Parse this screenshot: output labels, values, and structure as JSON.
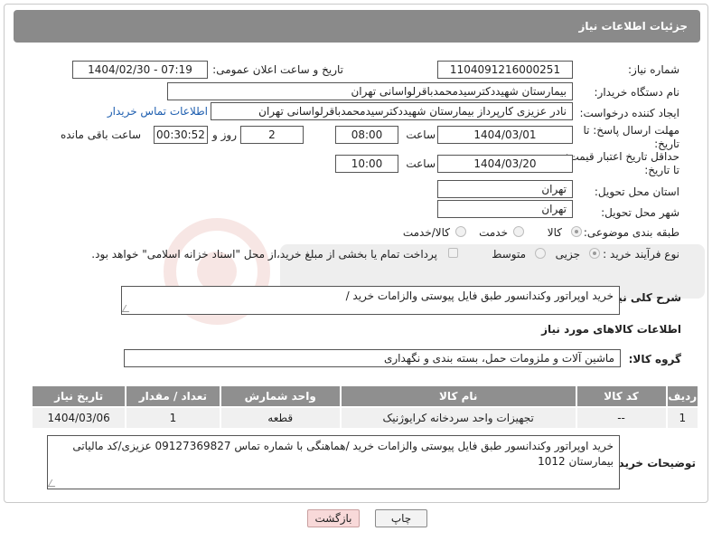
{
  "header": {
    "title": "جزئیات اطلاعات نیاز"
  },
  "fields": {
    "need_number_label": "شماره نیاز:",
    "need_number": "1104091216000251",
    "announce_label": "تاریخ و ساعت اعلان عمومی:",
    "announce_value": "1404/02/30 - 07:19",
    "buyer_org_label": "نام دستگاه خریدار:",
    "buyer_org": "بیمارستان شهیددکترسیدمحمدباقرلواسانی تهران",
    "creator_label": "ایجاد کننده درخواست:",
    "creator": "نادر  عزیزی کارپرداز بیمارستان شهیددکترسیدمحمدباقرلواسانی تهران",
    "contact_link": "اطلاعات تماس خریدار",
    "deadline_label_1": "مهلت ارسال پاسخ: تا",
    "deadline_label_2": "تاریخ:",
    "deadline_date": "1404/03/01",
    "time_label": "ساعت",
    "deadline_time": "08:00",
    "days_value": "2",
    "days_label": "روز و",
    "remaining_time": "00:30:52",
    "remaining_label": "ساعت باقی مانده",
    "min_validity_label_1": "حداقل تاریخ اعتبار قیمت:",
    "min_validity_label_2": "تا تاریخ:",
    "validity_date": "1404/03/20",
    "validity_time": "10:00",
    "province_label": "استان محل تحویل:",
    "province": "تهران",
    "city_label": "شهر محل تحویل:",
    "city": "تهران",
    "category_label": "طبقه بندی موضوعی:",
    "category_options": [
      "کالا",
      "خدمت",
      "کالا/خدمت"
    ],
    "process_label": "نوع فرآیند خرید :",
    "process_options": [
      "جزیی",
      "متوسط"
    ],
    "payment_note": "پرداخت تمام یا بخشی از مبلغ خرید،از محل \"اسناد خزانه اسلامی\" خواهد بود."
  },
  "summary": {
    "label": "شرح کلی نیاز:",
    "text": "خرید اوپراتور وکندانسور طبق فایل پیوستی والزامات خرید /"
  },
  "goods_section": {
    "title": "اطلاعات کالاهای مورد نیاز",
    "group_label": "گروه کالا:",
    "group_value": "ماشین آلات و ملزومات حمل، بسته بندی و نگهداری"
  },
  "table": {
    "headers": [
      "ردیف",
      "کد کالا",
      "نام کالا",
      "واحد شمارش",
      "تعداد / مقدار",
      "تاریخ نیاز"
    ],
    "rows": [
      [
        "1",
        "--",
        "تجهیزات واحد سردخانه کرایوژنیک",
        "قطعه",
        "1",
        "1404/03/06"
      ]
    ]
  },
  "buyer_notes": {
    "label": "توضیحات خریدار:",
    "text": "خرید اوپراتور وکندانسور طبق فایل پیوستی والزامات خرید /هماهنگی با شماره تماس 09127369827 عزیزی/کد مالیاتی بیمارستان 1012"
  },
  "buttons": {
    "print": "چاپ",
    "back": "بازگشت"
  },
  "colors": {
    "header_bg": "#8a8a8a",
    "link": "#1f5fb0",
    "back_btn": "#f8d9d9"
  }
}
